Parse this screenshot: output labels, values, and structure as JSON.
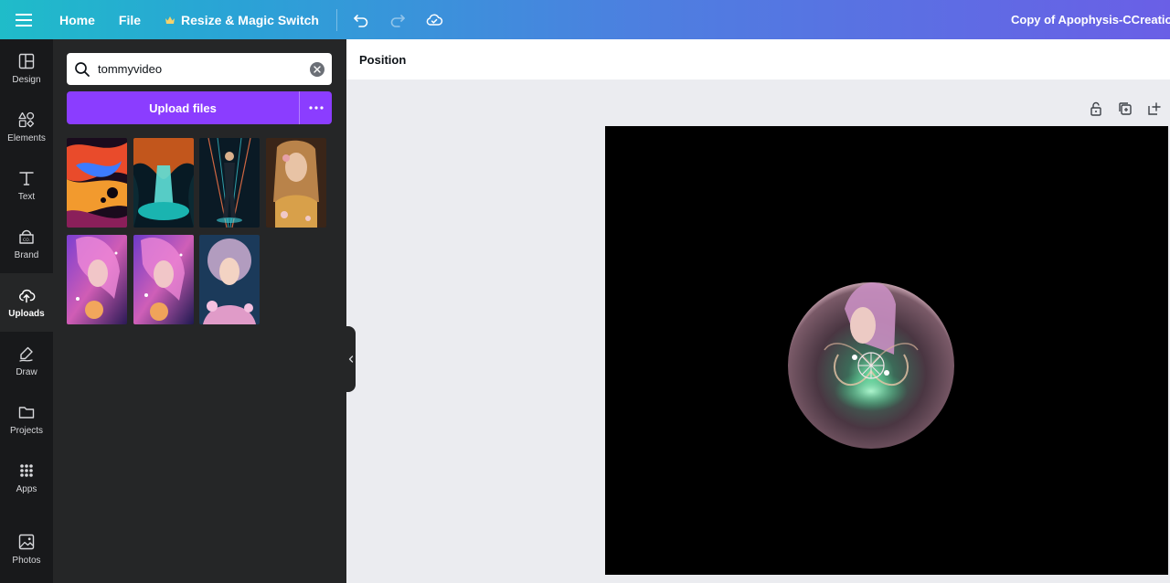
{
  "topbar": {
    "home": "Home",
    "file": "File",
    "resize": "Resize & Magic Switch",
    "doc_title": "Copy of Apophysis-CCreations"
  },
  "rail": [
    {
      "label": "Design",
      "icon": "layout-icon"
    },
    {
      "label": "Elements",
      "icon": "shapes-icon"
    },
    {
      "label": "Text",
      "icon": "text-icon"
    },
    {
      "label": "Brand",
      "icon": "brand-icon"
    },
    {
      "label": "Uploads",
      "icon": "upload-cloud-icon",
      "active": true
    },
    {
      "label": "Draw",
      "icon": "pen-icon"
    },
    {
      "label": "Projects",
      "icon": "folder-icon"
    },
    {
      "label": "Apps",
      "icon": "grid-icon"
    },
    {
      "label": "Photos",
      "icon": "image-icon"
    }
  ],
  "panel": {
    "search_value": "tommyvideo",
    "upload_label": "Upload files"
  },
  "context_toolbar": {
    "position_label": "Position"
  },
  "colors": {
    "accent": "#8b3dff",
    "rail_bg": "#18191b",
    "panel_bg": "#252627"
  }
}
